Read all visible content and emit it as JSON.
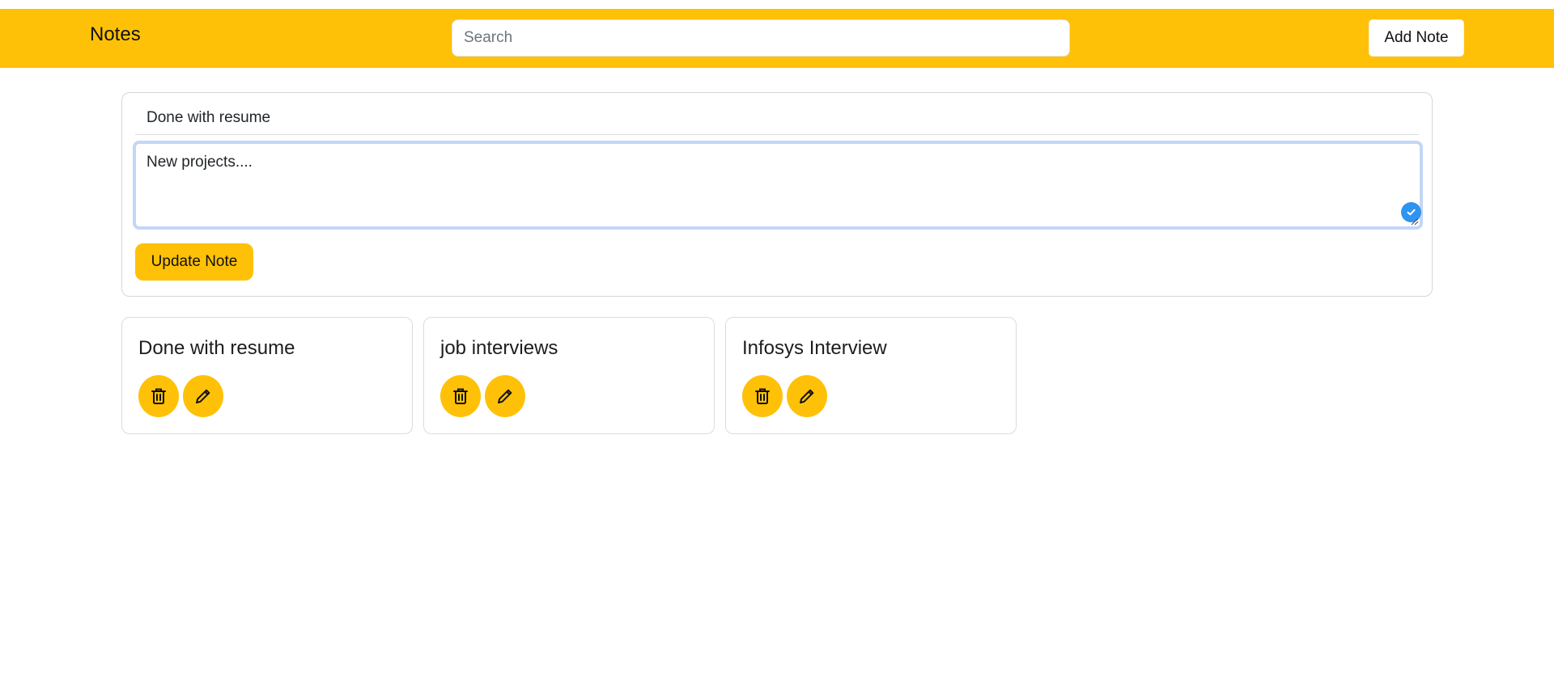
{
  "navbar": {
    "brand": "Notes",
    "search_placeholder": "Search",
    "search_value": "",
    "add_note_label": "Add Note",
    "color": "#ffc107"
  },
  "editor": {
    "title_value": "Done with resume",
    "body_value": "New projects....",
    "update_label": "Update Note"
  },
  "notes": [
    {
      "title": "Done with resume"
    },
    {
      "title": "job interviews"
    },
    {
      "title": "Infosys Interview"
    }
  ],
  "icons": {
    "delete": "trash-icon",
    "edit": "pencil-icon",
    "check": "check-circle-icon"
  }
}
